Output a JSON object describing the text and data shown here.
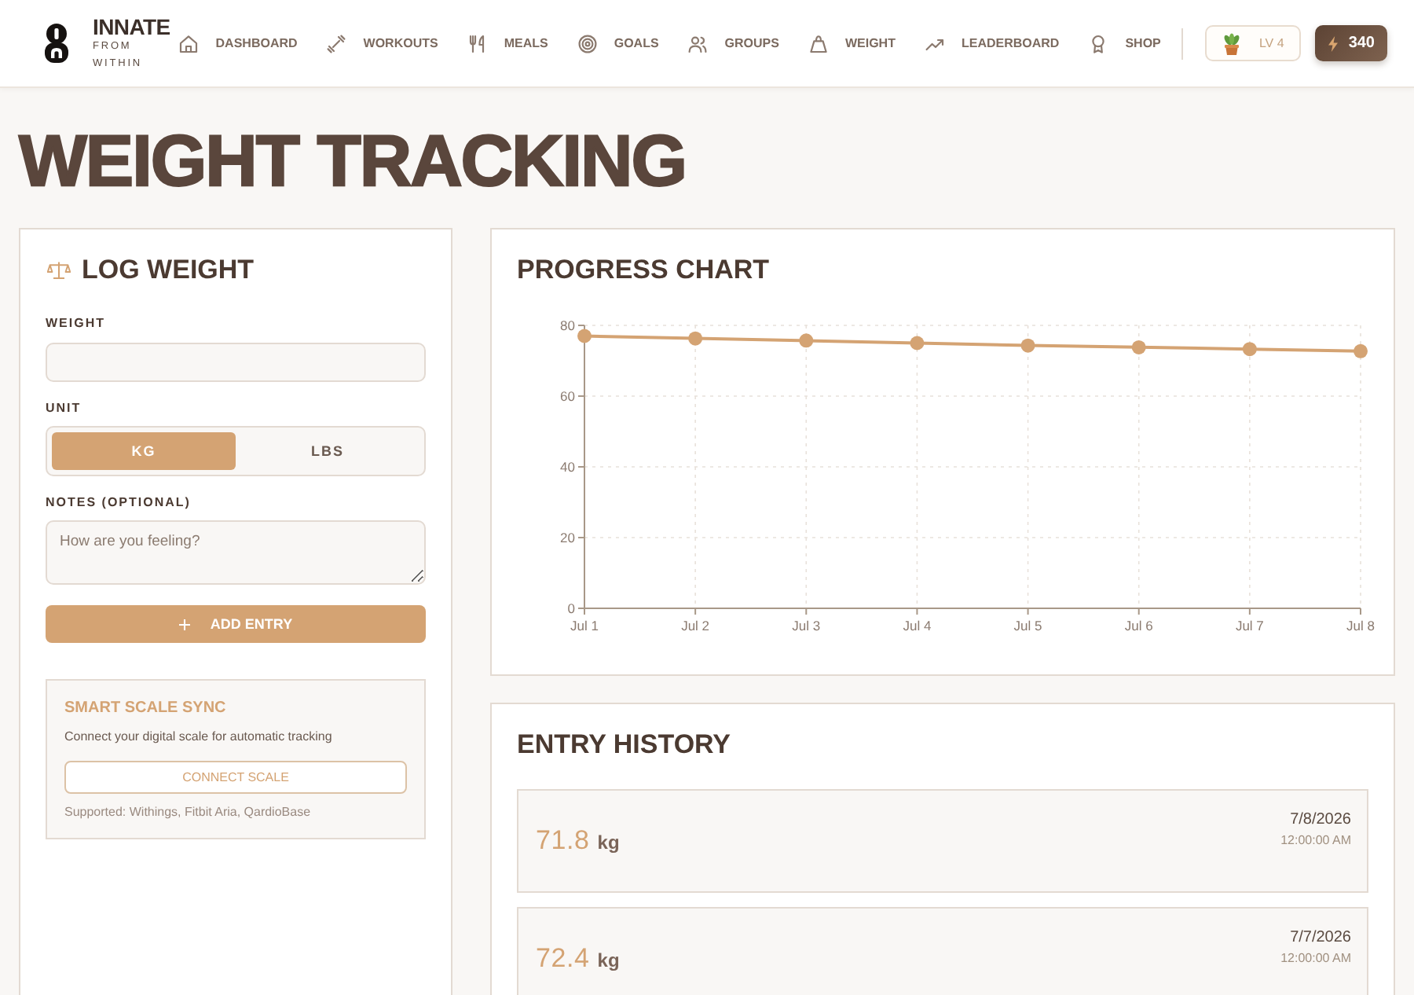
{
  "header": {
    "brand": {
      "name": "INNATE",
      "tagline": "FROM WITHIN"
    },
    "nav": [
      {
        "label": "DASHBOARD"
      },
      {
        "label": "WORKOUTS"
      },
      {
        "label": "MEALS"
      },
      {
        "label": "GOALS"
      },
      {
        "label": "GROUPS"
      },
      {
        "label": "WEIGHT"
      },
      {
        "label": "LEADERBOARD"
      },
      {
        "label": "SHOP"
      }
    ],
    "level_badge": {
      "label": "LV 4"
    },
    "points_badge": {
      "value": "340"
    }
  },
  "page_title": "WEIGHT TRACKING",
  "log_weight": {
    "title": "LOG WEIGHT",
    "weight_label": "WEIGHT",
    "unit_label": "UNIT",
    "unit_options": [
      {
        "label": "KG",
        "selected": true
      },
      {
        "label": "LBS",
        "selected": false
      }
    ],
    "notes_label": "NOTES (OPTIONAL)",
    "notes_field": {
      "placeholder": "How are you feeling?"
    },
    "add_button": {
      "label": "ADD ENTRY"
    },
    "smart_scale": {
      "title": "SMART SCALE SYNC",
      "description": "Connect your digital scale for automatic tracking",
      "button": {
        "label": "CONNECT SCALE"
      },
      "supported": "Supported: Withings, Fitbit Aria, QardioBase"
    }
  },
  "progress_chart": {
    "title": "PROGRESS CHART",
    "chart_data": {
      "type": "line",
      "categories": [
        "Jul 1",
        "Jul 2",
        "Jul 3",
        "Jul 4",
        "Jul 5",
        "Jul 6",
        "Jul 7",
        "Jul 8"
      ],
      "series": [
        {
          "color": "#d4a373",
          "marker": "circle",
          "values": [
            77.0,
            76.3,
            75.7,
            75.0,
            74.3,
            73.8,
            73.3,
            72.7
          ]
        }
      ],
      "ylim": [
        0,
        80
      ],
      "yticks": [
        0,
        20,
        40,
        60,
        80
      ],
      "grid": true
    }
  },
  "entry_history": {
    "title": "ENTRY HISTORY",
    "entries": [
      {
        "value": "71.8",
        "unit": "kg",
        "date": "7/8/2026",
        "time": "12:00:00 AM"
      },
      {
        "value": "72.4",
        "unit": "kg",
        "date": "7/7/2026",
        "time": "12:00:00 AM"
      }
    ]
  }
}
